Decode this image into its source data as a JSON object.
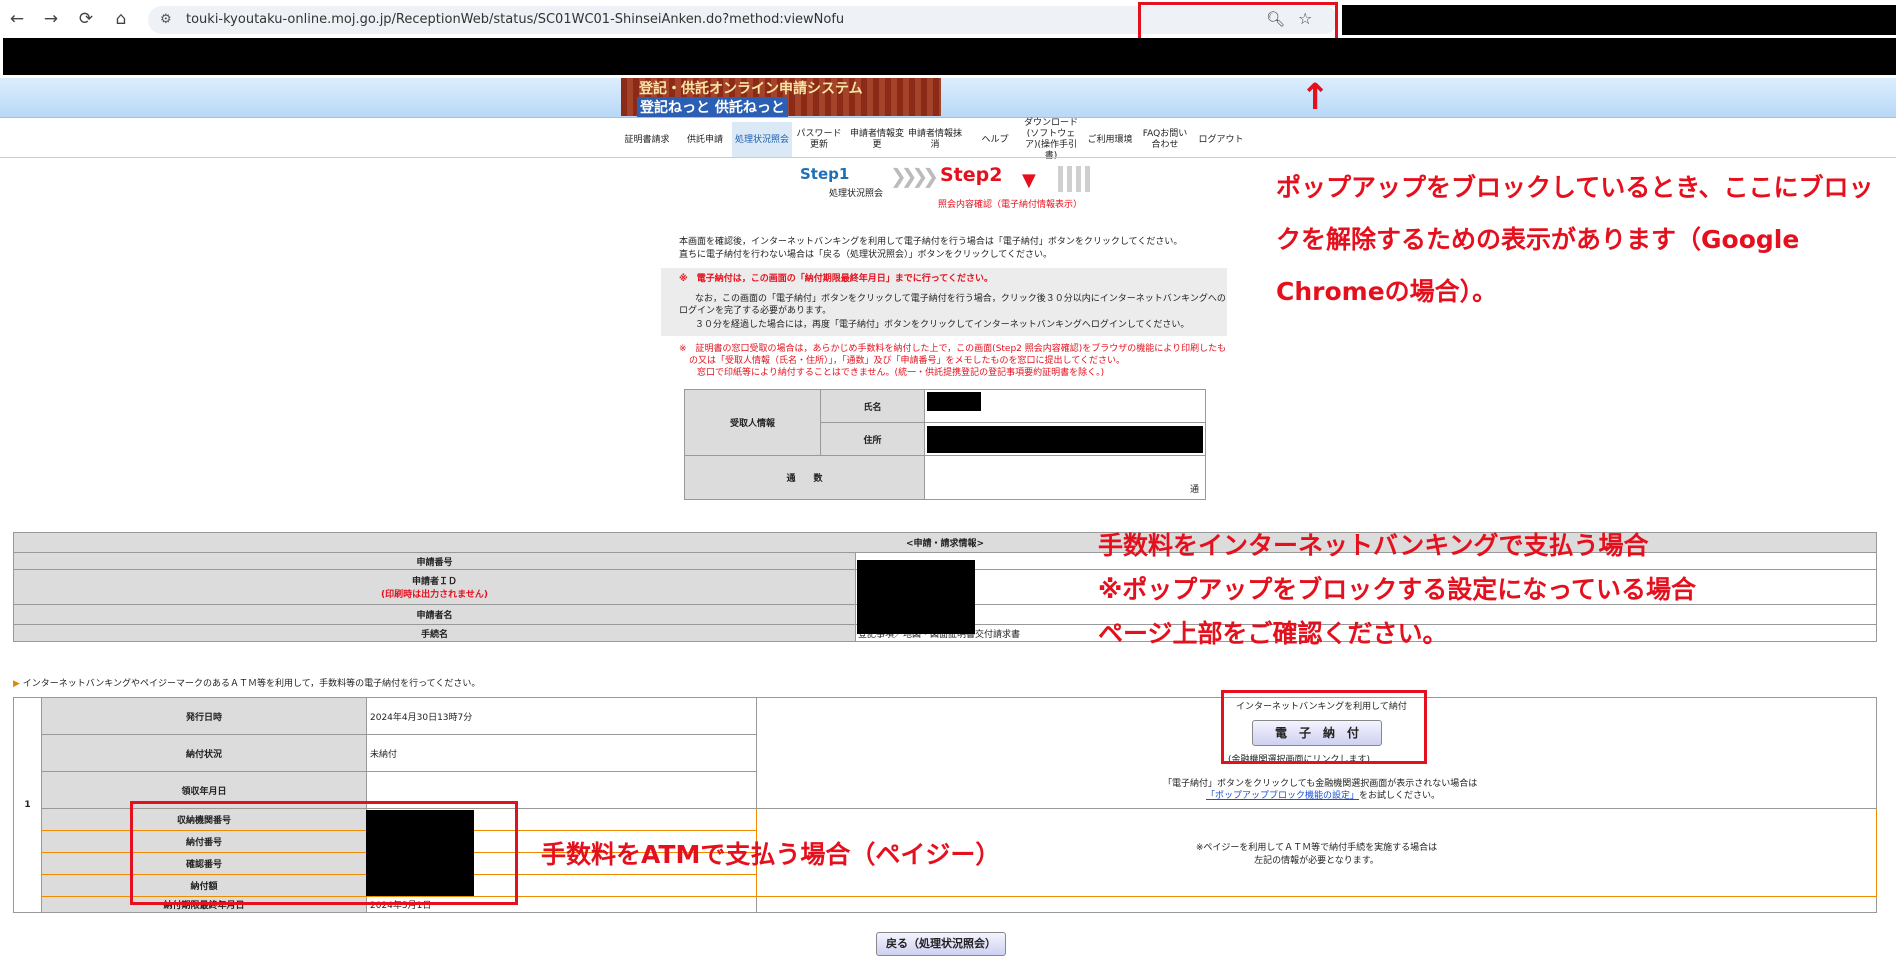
{
  "browser": {
    "url": "touki-kyoutaku-online.moj.go.jp/ReceptionWeb/status/SC01WC01-ShinseiAnken.do?method:viewNofu"
  },
  "site": {
    "logo_line1": "登記・供託オンライン申請システム",
    "logo_line2": "登記ねっと 供託ねっと"
  },
  "nav": [
    {
      "label": "証明書請求"
    },
    {
      "label": "供託申請"
    },
    {
      "label": "処理状況照会"
    },
    {
      "label": "パスワード更新"
    },
    {
      "label": "申請者情報変更"
    },
    {
      "label": "申請者情報抹消"
    },
    {
      "label": "ヘルプ"
    },
    {
      "label": "ダウンロード(ソフトウェア)(操作手引書)"
    },
    {
      "label": "ご利用環境"
    },
    {
      "label": "FAQお問い合わせ"
    },
    {
      "label": "ログアウト"
    }
  ],
  "steps": {
    "step1": "Step1",
    "step1_sub": "処理状況照会",
    "step2": "Step2",
    "step2_sub": "照会内容確認（電子納付情報表示）"
  },
  "notice": {
    "line1": "本画面を確認後，インターネットバンキングを利用して電子納付を行う場合は「電子納付」ボタンをクリックしてください。",
    "line2": "直ちに電子納付を行わない場合は「戻る（処理状況照会）」ボタンをクリックしてください。",
    "deadline": "※　電子納付は，この画面の「納付期限最終年月日」までに行ってください。",
    "box1": "なお，この画面の「電子納付」ボタンをクリックして電子納付を行う場合，クリック後３０分以内にインターネットバンキングへの",
    "box2": "ログインを完了する必要があります。",
    "box3": "３０分を経過した場合には，再度「電子納付」ボタンをクリックしてインターネットバンキングへログインしてください。",
    "red1": "※　証明書の窓口受取の場合は，あらかじめ手数料を納付した上で，この画面(Step2 照会内容確認)をブラウザの機能により印刷したも",
    "red2": "の又は「受取人情報（氏名・住所）」，「通数」及び「申請番号」をメモしたものを窓口に提出してください。",
    "red3": "窓口で印紙等により納付することはできません。(統一・供託提携登記の登記事項要約証明書を除く。)"
  },
  "recipient": {
    "section": "受取人情報",
    "name_label": "氏名",
    "address_label": "住所",
    "count_label": "通　　数",
    "count_unit": "通"
  },
  "application": {
    "title": "<申請・請求情報>",
    "rows": [
      {
        "label": "申請番号",
        "sub": "",
        "value": ""
      },
      {
        "label": "申請者ＩＤ",
        "sub": "(印刷時は出力されません)",
        "value": ""
      },
      {
        "label": "申請者名",
        "sub": "",
        "value": ""
      },
      {
        "label": "手続名",
        "sub": "",
        "value": "登記事項／地図・図面証明書交付請求書"
      }
    ]
  },
  "payment": {
    "intro": "インターネットバンキングやペイジーマークのあるＡＴＭ等を利用して，手数料等の電子納付を行ってください。",
    "row_no": "1",
    "rows": [
      {
        "label": "発行日時",
        "value": "2024年4月30日13時7分"
      },
      {
        "label": "納付状況",
        "value": "未納付"
      },
      {
        "label": "領収年月日",
        "value": ""
      },
      {
        "label": "収納機関番号",
        "value": ""
      },
      {
        "label": "納付番号",
        "value": ""
      },
      {
        "label": "確認番号",
        "value": ""
      },
      {
        "label": "納付額",
        "value": ""
      },
      {
        "label": "納付期限最終年月日",
        "value": "2024年5月1日"
      }
    ],
    "ib_caption": "インターネットバンキングを利用して納付",
    "epay_button": "電　子　納　付",
    "ib_note": "(金融機関選択画面にリンクします)",
    "popup_note": "「電子納付」ボタンをクリックしても金融機関選択画面が表示されない場合は",
    "popup_link": "「ポップアップブロック機能の設定」",
    "popup_suffix": "をお試しください。",
    "payeasy1": "※ペイジーを利用してＡＴＭ等で納付手続を実施する場合は",
    "payeasy2": "左記の情報が必要となります。",
    "back_button": "戻る（処理状況照会）"
  },
  "annotations": {
    "popup1": "ポップアップをブロックしているとき、ここにブロッ",
    "popup2": "クを解除するための表示があります（Google",
    "popup3": "Chromeの場合）。",
    "ib1": "手数料をインターネットバンキングで支払う場合",
    "ib2": "※ポップアップをブロックする設定になっている場合",
    "ib3": "ページ上部をご確認ください。",
    "atm": "手数料をATMで支払う場合（ペイジー）",
    "arrow": "↑"
  }
}
